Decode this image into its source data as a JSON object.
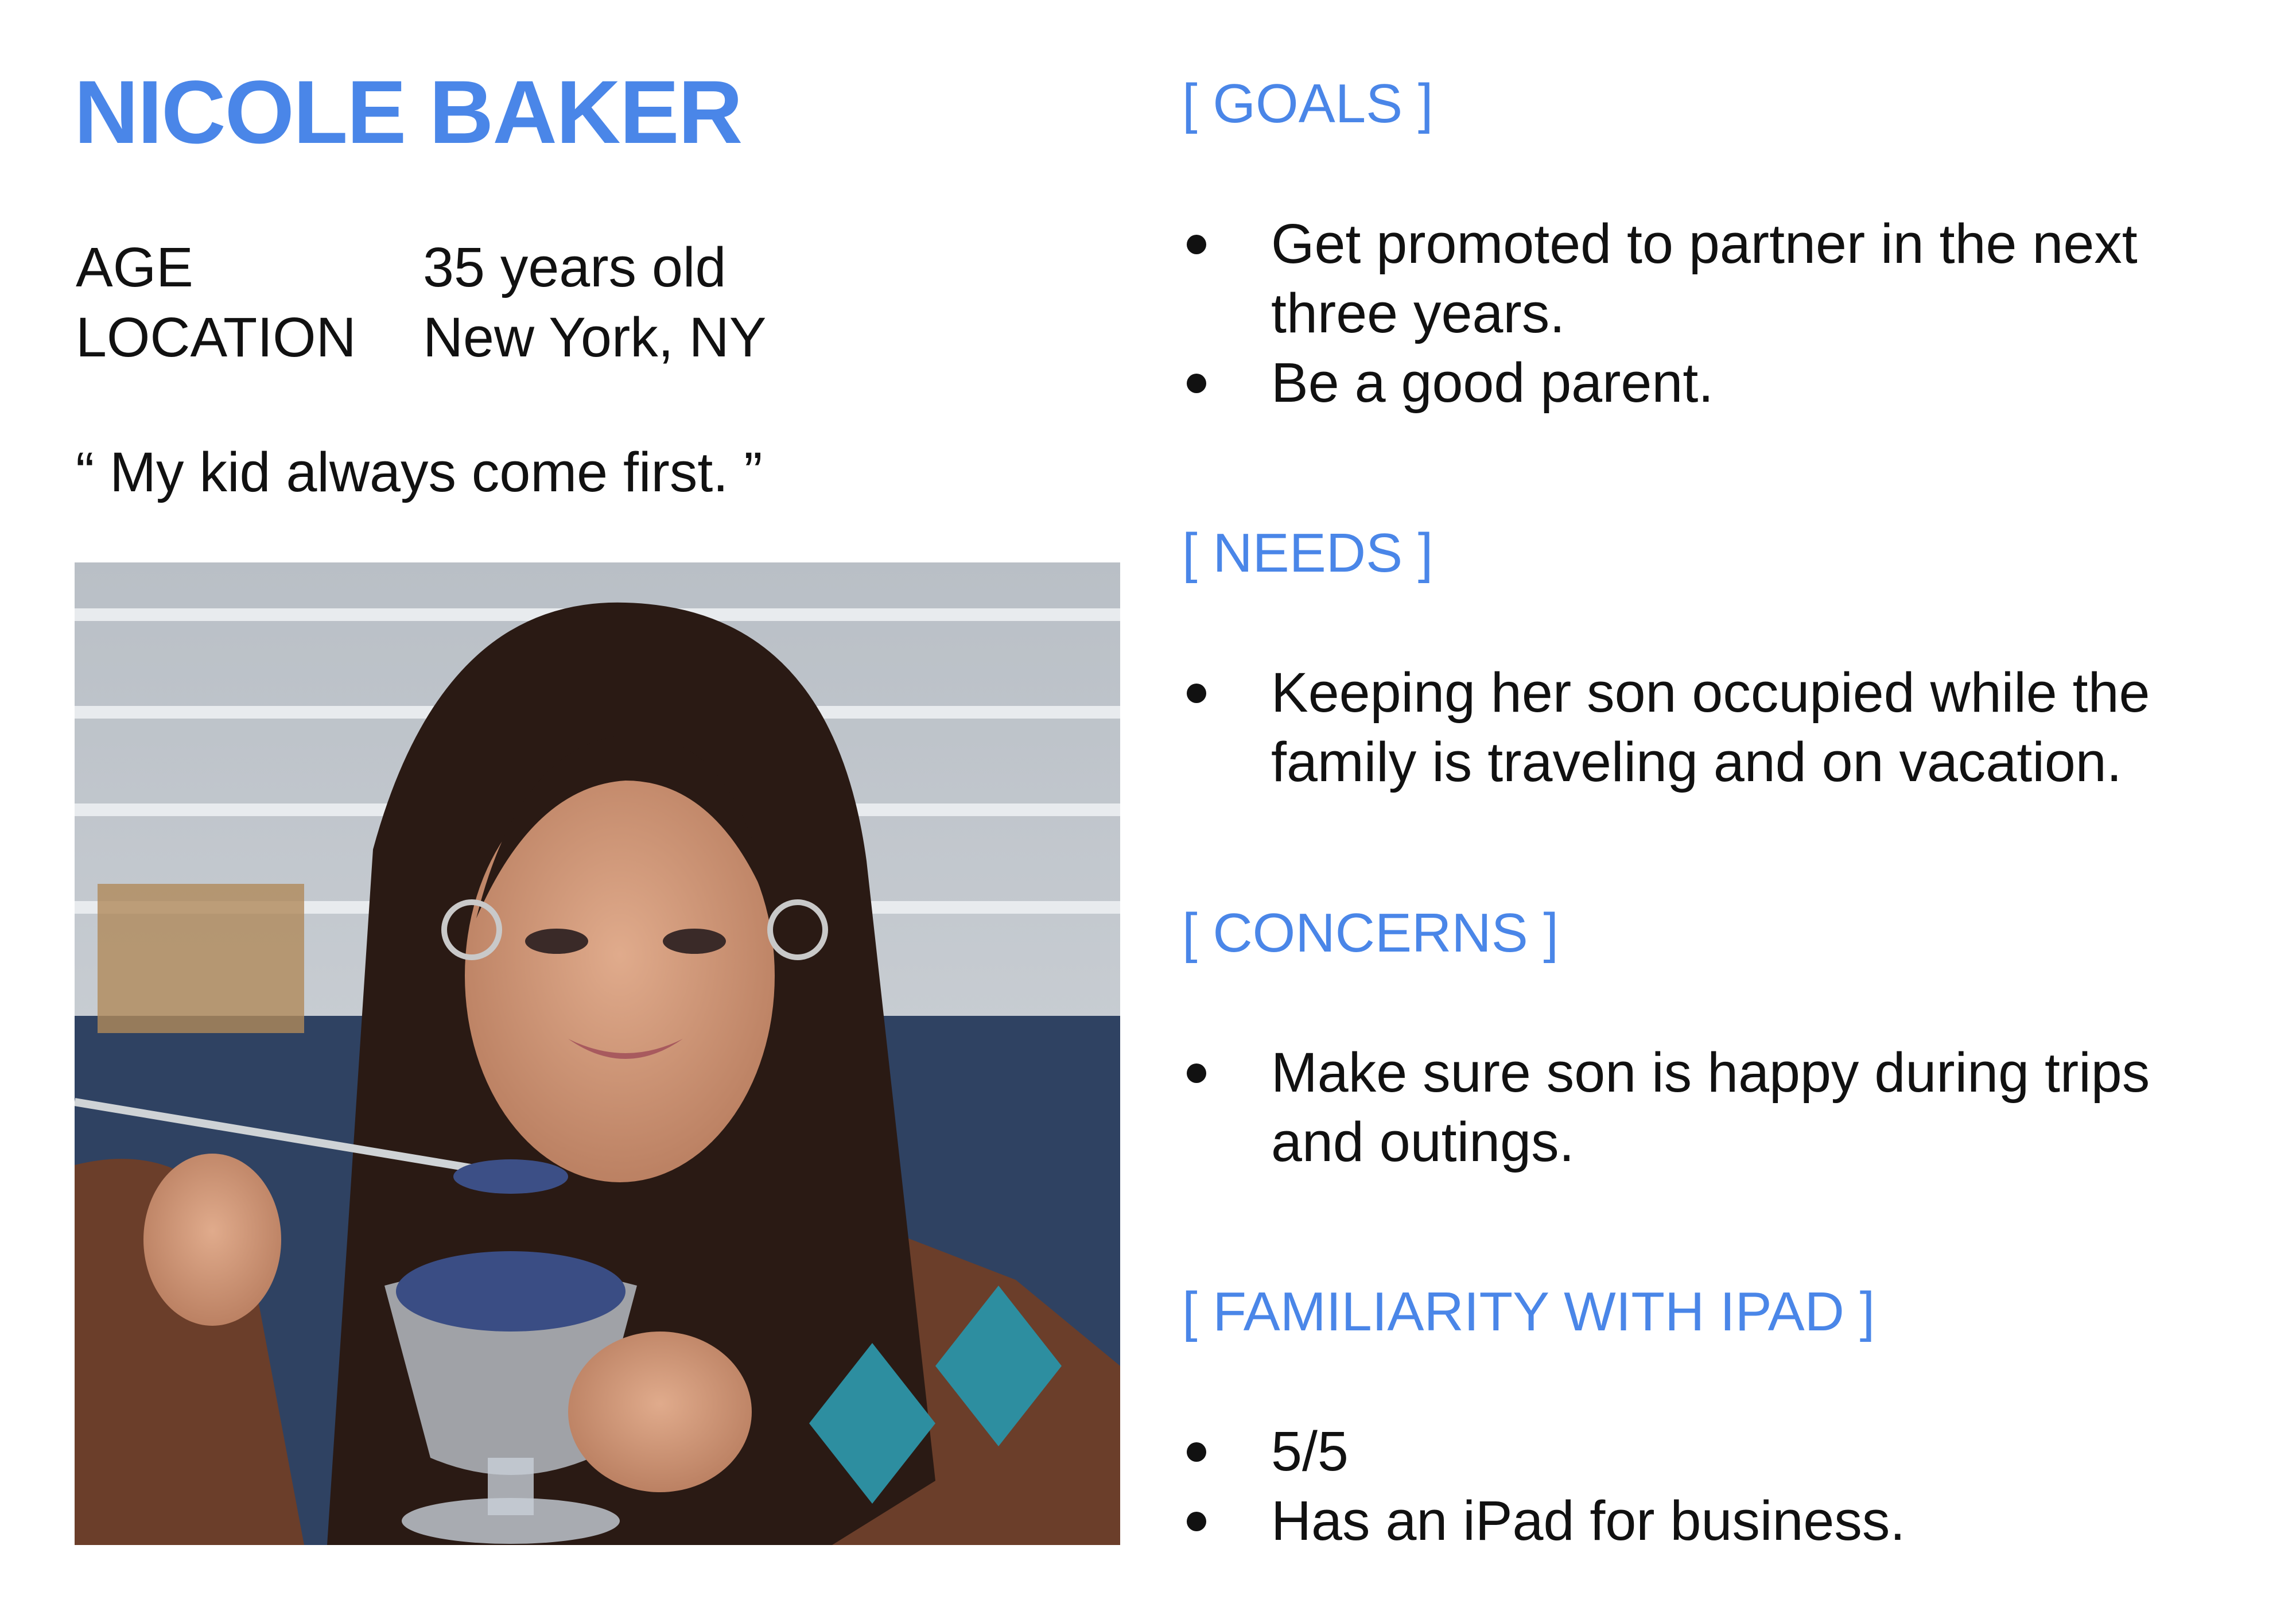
{
  "persona": {
    "name": "NICOLE BAKER",
    "facts": [
      {
        "label": "AGE",
        "value": "35 years old"
      },
      {
        "label": "LOCATION",
        "value": "New York, NY"
      }
    ],
    "quote": "“ My kid always come first. ”"
  },
  "sections": [
    {
      "title": "[ GOALS ]",
      "items": [
        "Get promoted to partner in the next three years.",
        "Be a good parent."
      ]
    },
    {
      "title": "[ NEEDS ]",
      "items": [
        "Keeping her son occupied while the family is traveling and on vacation."
      ]
    },
    {
      "title": "[ CONCERNS ]",
      "items": [
        "Make sure son is happy during trips and outings."
      ]
    },
    {
      "title": "[ FAMILIARITY WITH IPAD ]",
      "items": [
        "5/5",
        "Has an iPad for business."
      ]
    }
  ],
  "colors": {
    "accent": "#4a86e8",
    "text": "#111111"
  }
}
